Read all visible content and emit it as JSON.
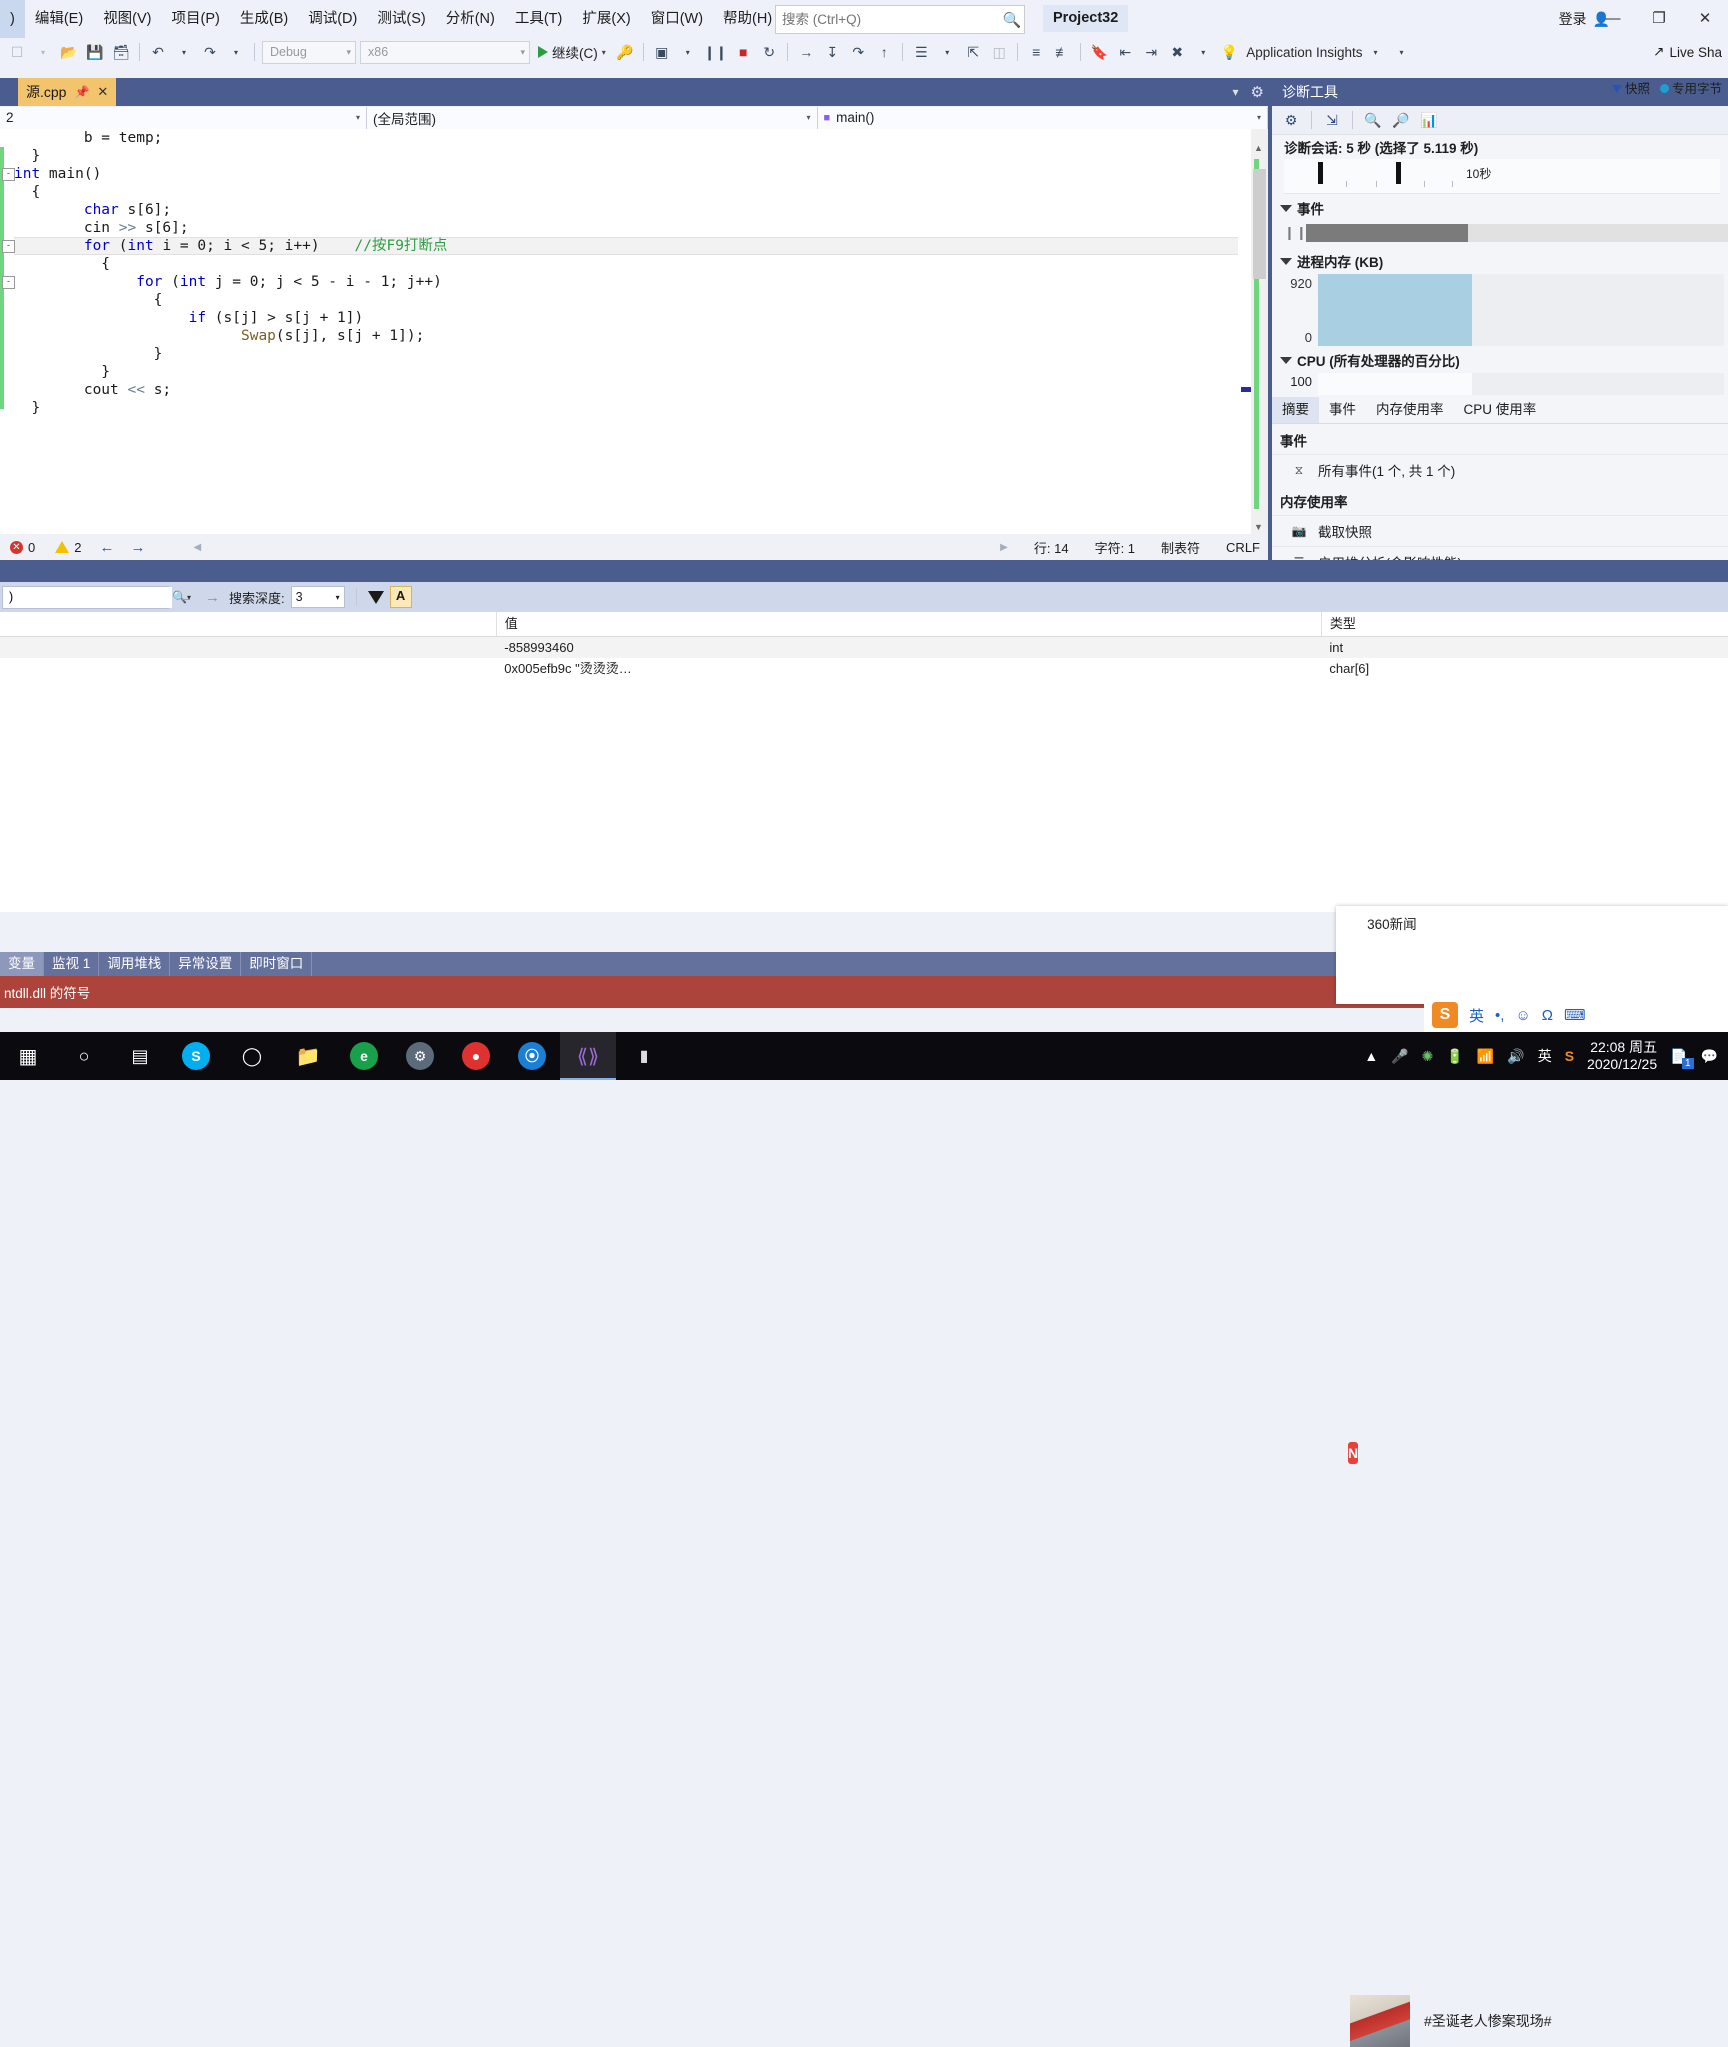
{
  "titlebar": {
    "menu_items": [
      ")",
      "编辑(E)",
      "视图(V)",
      "项目(P)",
      "生成(B)",
      "调试(D)",
      "测试(S)",
      "分析(N)",
      "工具(T)",
      "扩展(X)",
      "窗口(W)",
      "帮助(H)"
    ],
    "search_placeholder": "搜索 (Ctrl+Q)",
    "search_icon": "search-icon",
    "project_badge": "Project32",
    "login_label": "登录",
    "login_icon": "account-icon",
    "minimize": "—",
    "restore": "❐",
    "close": "✕"
  },
  "toolbar": {
    "config": "Debug",
    "platform": "x86",
    "run_label": "继续(C)",
    "app_insights": "Application Insights",
    "live_share": "Live Sha",
    "icons": [
      "new-project-icon",
      "open-file-icon",
      "save-icon",
      "save-all-icon",
      "undo-icon",
      "redo-icon",
      "start-debug-icon",
      "hot-reload-icon",
      "break-all-icon",
      "stop-debug-icon",
      "restart-icon",
      "step-over-icon",
      "step-into-icon",
      "step-out-icon",
      "step-up-icon",
      "diff-icon",
      "pointer-icon",
      "window-icon",
      "compare-icon",
      "indent-icon",
      "comment-icon",
      "bookmark-icon",
      "prev-bookmark-icon",
      "next-bookmark-icon",
      "clear-bookmark-icon",
      "lightbulb-icon"
    ]
  },
  "editor": {
    "tab_name": "源.cpp",
    "pin_icon": "pin-icon",
    "close_icon": "close-icon",
    "tab_dropdown_icon": "chevron-down-icon",
    "tab_settings_icon": "gear-icon",
    "nav_project": "2",
    "nav_scope": "(全局范围)",
    "nav_member": "main()",
    "nav_member_icon": "method-icon",
    "code_lines": [
      {
        "indent": 4,
        "text": "b = temp;",
        "fold": null,
        "hl": false
      },
      {
        "indent": 1,
        "text": "}",
        "fold": null,
        "hl": false
      },
      {
        "indent": 0,
        "text": "int main()",
        "fold": "-",
        "hl": false
      },
      {
        "indent": 1,
        "text": "{",
        "fold": null,
        "hl": false
      },
      {
        "indent": 4,
        "text": "char s[6];",
        "fold": null,
        "hl": false
      },
      {
        "indent": 4,
        "text": "cin >> s[6];",
        "fold": null,
        "hl": false
      },
      {
        "indent": 4,
        "text": "for (int i = 0; i < 5; i++)    //按F9打断点",
        "fold": "-",
        "hl": true
      },
      {
        "indent": 5,
        "text": "{",
        "fold": null,
        "hl": false
      },
      {
        "indent": 7,
        "text": "for (int j = 0; j < 5 - i - 1; j++)",
        "fold": "-",
        "hl": false
      },
      {
        "indent": 8,
        "text": "{",
        "fold": null,
        "hl": false
      },
      {
        "indent": 10,
        "text": "if (s[j] > s[j + 1])",
        "fold": null,
        "hl": false
      },
      {
        "indent": 13,
        "text": "Swap(s[j], s[j + 1]);",
        "fold": null,
        "hl": false
      },
      {
        "indent": 8,
        "text": "}",
        "fold": null,
        "hl": false
      },
      {
        "indent": 5,
        "text": "}",
        "fold": null,
        "hl": false
      },
      {
        "indent": 4,
        "text": "cout << s;",
        "fold": null,
        "hl": false
      },
      {
        "indent": 1,
        "text": "}",
        "fold": null,
        "hl": false
      }
    ],
    "status": {
      "error_count": "0",
      "warning_count": "2",
      "prev_icon": "arrow-left-icon",
      "next_icon": "arrow-right-icon",
      "line_label": "行: 14",
      "char_label": "字符: 1",
      "tab_label": "制表符",
      "eol_label": "CRLF"
    }
  },
  "diagnostics": {
    "title": "诊断工具",
    "toolbar_icons": [
      "gear-icon",
      "export-icon",
      "zoom-in-icon",
      "zoom-out-icon",
      "chart-icon"
    ],
    "session_label": "诊断会话: 5 秒 (选择了 5.119 秒)",
    "ruler_label": "10秒",
    "events_section": "事件",
    "events_pause_icon": "pause-icon",
    "memory_section": "进程内存 (KB)",
    "memory_max": "920",
    "memory_min": "0",
    "legend_snapshot": "快照",
    "legend_private": "专用字节",
    "cpu_section": "CPU (所有处理器的百分比)",
    "cpu_max": "100",
    "tabs": [
      "摘要",
      "事件",
      "内存使用率",
      "CPU 使用率"
    ],
    "active_tab": "摘要",
    "summary": {
      "events_head": "事件",
      "events_row": "所有事件(1 个, 共 1 个)",
      "events_row_icon": "events-icon",
      "memory_head": "内存使用率",
      "memory_row": "截取快照",
      "memory_row_icon": "camera-icon",
      "heap_row": "启用堆分析(会影响性能)",
      "heap_row_icon": "heap-icon"
    }
  },
  "watch": {
    "search_value": ")",
    "search_icon": "search-icon",
    "prev_icon": "arrow-left-icon",
    "next_icon": "arrow-right-icon",
    "depth_label": "搜索深度:",
    "depth_value": "3",
    "filter_icon": "funnel-icon",
    "hex_icon": "format-a-icon",
    "columns": [
      "",
      "值",
      "类型"
    ],
    "rows": [
      {
        "name": "",
        "value": "-858993460",
        "type": "int"
      },
      {
        "name": "",
        "value": "0x005efb9c \"烫烫烫…",
        "type": "char[6]"
      }
    ],
    "bottom_tabs": [
      "变量",
      "监视 1",
      "调用堆栈",
      "异常设置",
      "即时窗口"
    ],
    "bottom_active": "变量",
    "output_text": "ntdll.dll 的符号"
  },
  "toast": {
    "app_name": "360新闻",
    "logo_letter": "N",
    "headline": "#圣诞老人惨案现场#",
    "thumb_name": "news-thumbnail"
  },
  "ime": {
    "logo_letter": "S",
    "mode": "英",
    "items": [
      "•,",
      "☺",
      "Ω",
      "⌨"
    ]
  },
  "taskbar": {
    "items": [
      "start-icon",
      "search-icon",
      "task-view-icon",
      "skype-icon",
      "cortana-icon",
      "file-explorer-icon",
      "edge-icon",
      "settings-icon",
      "recording-icon",
      "browser-icon",
      "vs-code-icon",
      "terminal-icon"
    ],
    "tray": [
      "show-hidden-icon",
      "mic-icon",
      "shield-icon",
      "battery-icon",
      "wifi-icon",
      "volume-icon"
    ],
    "ime_indicator": "英",
    "sogou_icon": "sogou-icon",
    "time": "22:08 周五",
    "date": "2020/12/25",
    "notification_count": "1",
    "notification_icon": "notification-icon",
    "action_center_icon": "action-center-icon"
  }
}
